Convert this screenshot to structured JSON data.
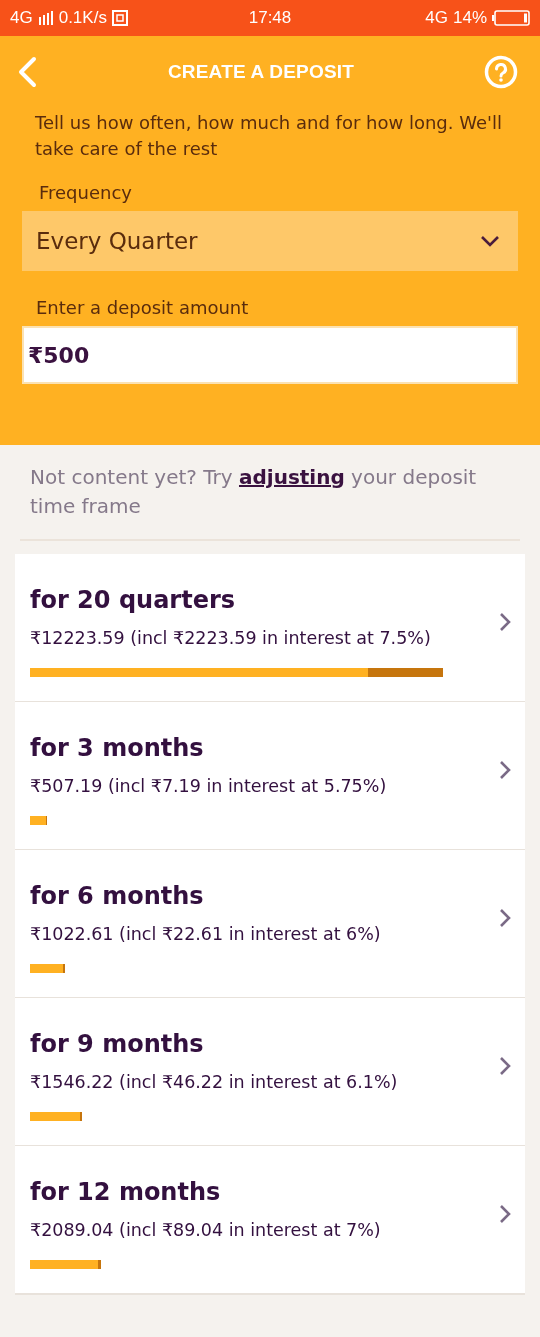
{
  "status_bar": {
    "network": "4G",
    "speed": "0.1K/s",
    "time": "17:48",
    "data_type": "4G",
    "battery": "14%"
  },
  "header": {
    "title": "CREATE A DEPOSIT"
  },
  "intro": "Tell us how often, how much and for how long.  We'll take care of the rest",
  "frequency": {
    "label": "Frequency",
    "value": "Every Quarter"
  },
  "amount": {
    "label": "Enter a deposit amount",
    "value": "₹500"
  },
  "hint": {
    "before": "Not content yet? Try ",
    "link": "adjusting",
    "after": " your deposit time frame"
  },
  "options": [
    {
      "title": "for 20 quarters",
      "detail": "₹12223.59 (incl ₹2223.59 in interest at 7.5%)"
    },
    {
      "title": "for 3 months",
      "detail": "₹507.19 (incl ₹7.19 in interest at 5.75%)"
    },
    {
      "title": "for 6 months",
      "detail": "₹1022.61 (incl ₹22.61 in interest at 6%)"
    },
    {
      "title": "for 9 months",
      "detail": "₹1546.22 (incl ₹46.22 in interest at 6.1%)"
    },
    {
      "title": "for 12 months",
      "detail": "₹2089.04 (incl ₹89.04 in interest at 7%)"
    }
  ]
}
